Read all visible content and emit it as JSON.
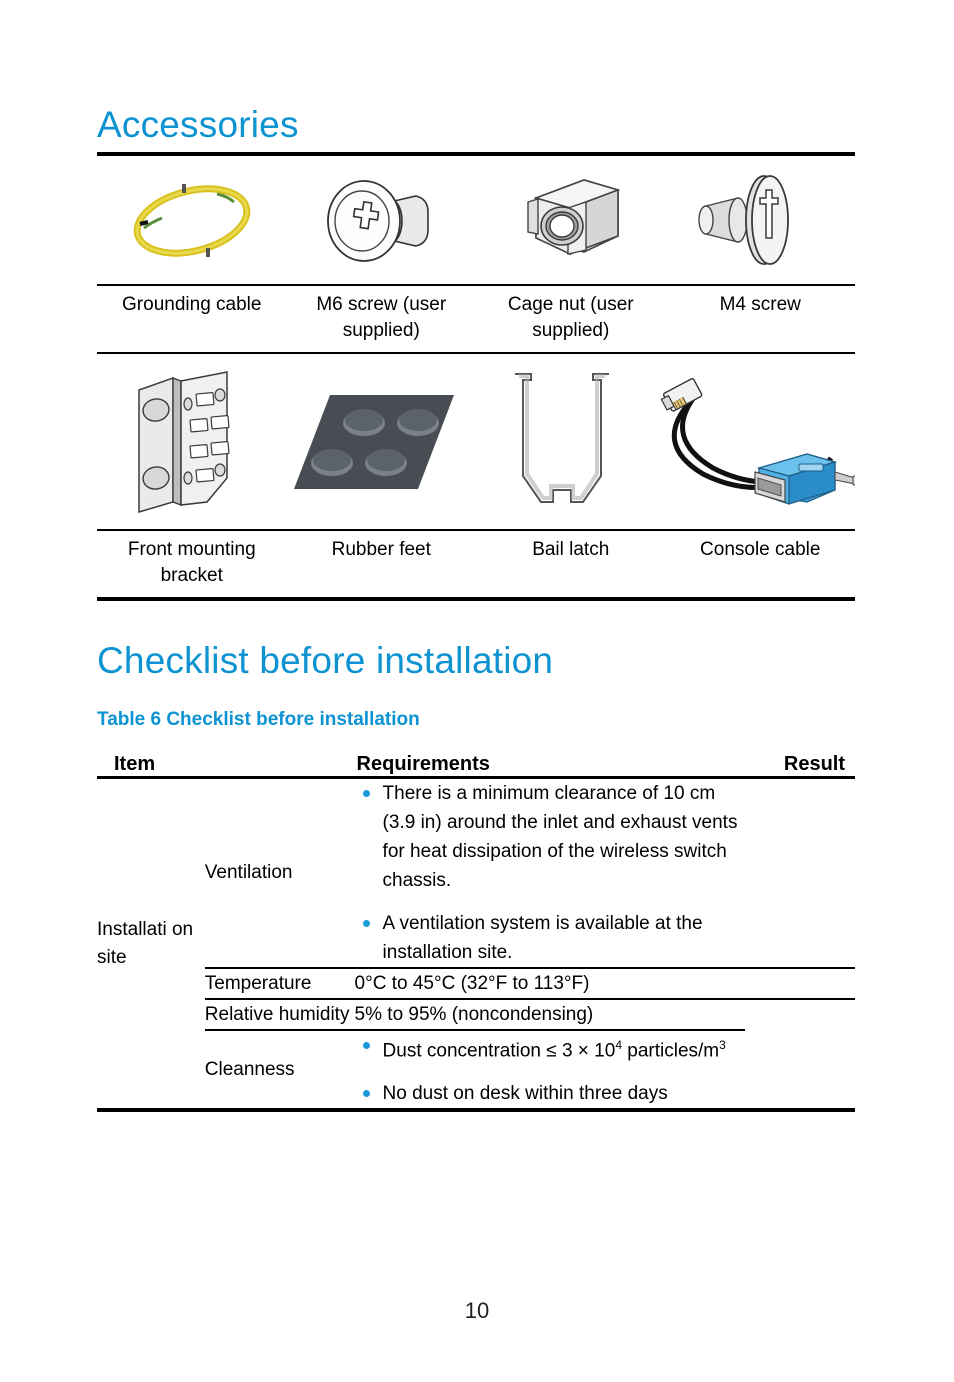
{
  "sections": {
    "accessories": {
      "heading": "Accessories",
      "items": [
        {
          "label": "Grounding cable",
          "icon": "grounding-cable-illustration"
        },
        {
          "label": "M6 screw (user supplied)",
          "icon": "m6-screw-illustration"
        },
        {
          "label": "Cage nut (user supplied)",
          "icon": "cage-nut-illustration"
        },
        {
          "label": "M4 screw",
          "icon": "m4-screw-illustration"
        },
        {
          "label": "Front mounting bracket",
          "icon": "front-mounting-bracket-illustration"
        },
        {
          "label": "Rubber feet",
          "icon": "rubber-feet-illustration"
        },
        {
          "label": "Bail latch",
          "icon": "bail-latch-illustration"
        },
        {
          "label": "Console cable",
          "icon": "console-cable-illustration"
        }
      ]
    },
    "checklist": {
      "heading": "Checklist before installation",
      "table_caption": "Table 6 Checklist before installation",
      "columns": [
        "Item",
        "Requirements",
        "Result"
      ],
      "item_label": "Installati on site",
      "rows": [
        {
          "subitem": "Ventilation",
          "requirement_bullets": [
            "There is a minimum clearance of 10 cm (3.9 in) around the inlet and exhaust vents for heat dissipation of the wireless switch chassis.",
            "A ventilation system is available at the installation site."
          ],
          "result": ""
        },
        {
          "subitem": "Temperature",
          "requirement_text": "0°C to 45°C (32°F to 113°F)",
          "result": ""
        },
        {
          "subitem": "Relative humidity",
          "requirement_text": "5% to 95% (noncondensing)",
          "result": ""
        },
        {
          "subitem": "Cleanness",
          "requirement_bullets_rich": [
            {
              "pre": "Dust concentration ≤ 3 × 10",
              "sup1": "4",
              "mid": " particles/m",
              "sup2": "3"
            }
          ],
          "requirement_bullets_plain": [
            "No dust on desk within three days"
          ],
          "result": ""
        }
      ]
    }
  },
  "footer": {
    "page_number": "10"
  },
  "colors": {
    "heading_blue": "#0d93d2",
    "bullet_blue": "#1b9ad6",
    "rule_black": "#000000"
  }
}
